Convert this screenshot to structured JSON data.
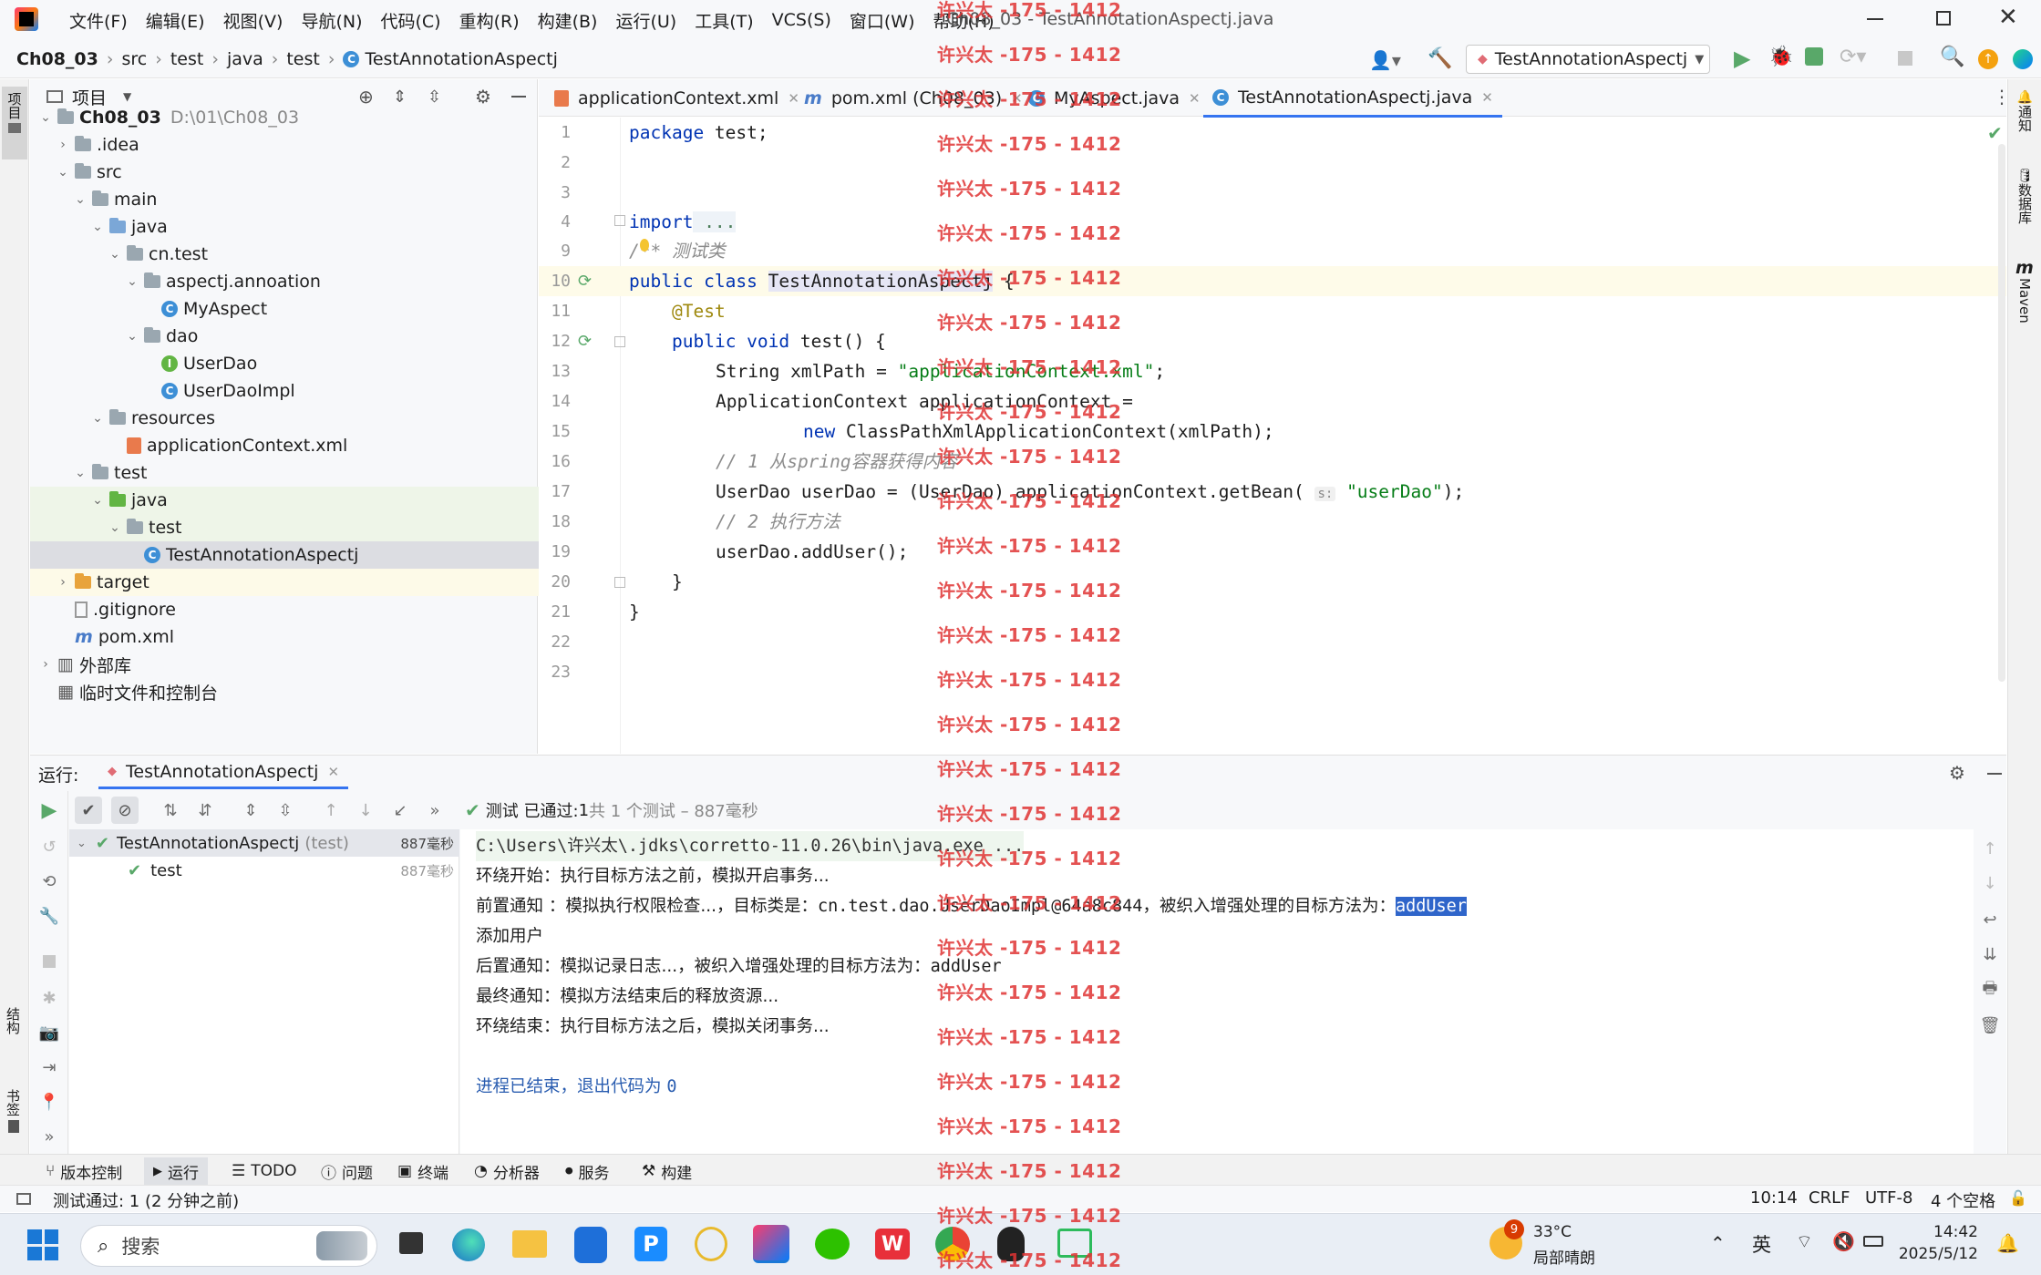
{
  "menu": [
    "文件(F)",
    "编辑(E)",
    "视图(V)",
    "导航(N)",
    "代码(C)",
    "重构(R)",
    "构建(B)",
    "运行(U)",
    "工具(T)",
    "VCS(S)",
    "窗口(W)",
    "帮助(H)"
  ],
  "window_title": "Ch08_03 - TestAnnotationAspectj.java",
  "breadcrumb": [
    "Ch08_03",
    "src",
    "test",
    "java",
    "test",
    "TestAnnotationAspectj"
  ],
  "run_config": "TestAnnotationAspectj",
  "project_panel": {
    "title": "项目",
    "root_name": "Ch08_03",
    "root_path": "D:\\01\\Ch08_03",
    "items": [
      ".idea",
      "src",
      "main",
      "java",
      "cn.test",
      "aspectj.annoation",
      "MyAspect",
      "dao",
      "UserDao",
      "UserDaoImpl",
      "resources",
      "applicationContext.xml",
      "test",
      "java",
      "test",
      "TestAnnotationAspectj",
      "target",
      ".gitignore",
      "pom.xml",
      "外部库",
      "临时文件和控制台"
    ]
  },
  "tabs": [
    "applicationContext.xml",
    "pom.xml (Ch08_03)",
    "MyAspect.java",
    "TestAnnotationAspectj.java"
  ],
  "line_numbers": [
    "1",
    "2",
    "3",
    "4",
    "9",
    "10",
    "11",
    "12",
    "13",
    "14",
    "15",
    "16",
    "17",
    "18",
    "19",
    "20",
    "21",
    "22",
    "23"
  ],
  "code": {
    "l1_kw": "package",
    "l1_rest": " test;",
    "l4_kw": "import",
    "l4_rest": " ...",
    "l9": "/** 测试类",
    "l10_kw": "public class",
    "l10_cls": "TestAnnotationAspectj",
    "l10_rest": " {",
    "l11": "@Test",
    "l12_kw": "public void",
    "l12_rest": " test() {",
    "l13_a": "String xmlPath = ",
    "l13_s": "\"applicationContext.xml\"",
    "l13_b": ";",
    "l14": "ApplicationContext applicationContext =",
    "l15_kw": "new",
    "l15_rest": " ClassPathXmlApplicationContext(xmlPath);",
    "l16": "// 1 从spring容器获得内容",
    "l17_a": "UserDao userDao = (UserDao) applicationContext.getBean(",
    "l17_hint": "s:",
    "l17_s": "\"userDao\"",
    "l17_b": ");",
    "l18": "// 2 执行方法",
    "l19": "userDao.addUser();",
    "l20": "}",
    "l21": "}"
  },
  "run_panel": {
    "label": "运行:",
    "tab": "TestAnnotationAspectj",
    "status_prefix": "测试 已通过: ",
    "status_count": "1",
    "status_suffix": "共 1 个测试 – 887毫秒",
    "tree": [
      {
        "name": "TestAnnotationAspectj",
        "suffix": "(test)",
        "time": "887毫秒"
      },
      {
        "name": "test",
        "time": "887毫秒"
      }
    ],
    "output": {
      "cmd": "C:\\Users\\许兴太\\.jdks\\corretto-11.0.26\\bin\\java.exe ...",
      "l1": "环绕开始：执行目标方法之前，模拟开启事务...",
      "l2_a": "前置通知 ：模拟执行权限检查...，目标类是：",
      "l2_b": "cn.test.dao.UserDaoImpl@64a8c844",
      "l2_c": "，被织入增强处理的目标方法为：",
      "l2_sel": "addUser",
      "l3": "添加用户",
      "l4_a": "后置通知：模拟记录日志...，被织入增强处理的目标方法为：",
      "l4_b": "addUser",
      "l5": "最终通知：模拟方法结束后的释放资源...",
      "l6": "环绕结束：执行目标方法之后，模拟关闭事务...",
      "l7_a": "进程已结束，退出代码为 ",
      "l7_b": "0"
    }
  },
  "bottom_tools": [
    "版本控制",
    "运行",
    "TODO",
    "问题",
    "终端",
    "分析器",
    "服务",
    "构建"
  ],
  "statusbar": {
    "message": "测试通过: 1 (2 分钟之前)",
    "position": "10:14",
    "line_sep": "CRLF",
    "encoding": "UTF-8",
    "indent": "4 个空格"
  },
  "right_strip": [
    "通知",
    "数据库",
    "Maven"
  ],
  "left_strip": [
    "项目",
    "结构",
    "书签"
  ],
  "watermark": "许兴太 -175 - 1412",
  "taskbar": {
    "search_placeholder": "搜索",
    "weather_badge": "9",
    "temp": "33°C",
    "weather": "局部晴朗",
    "ime": "英",
    "time": "14:42",
    "date": "2025/5/12"
  }
}
